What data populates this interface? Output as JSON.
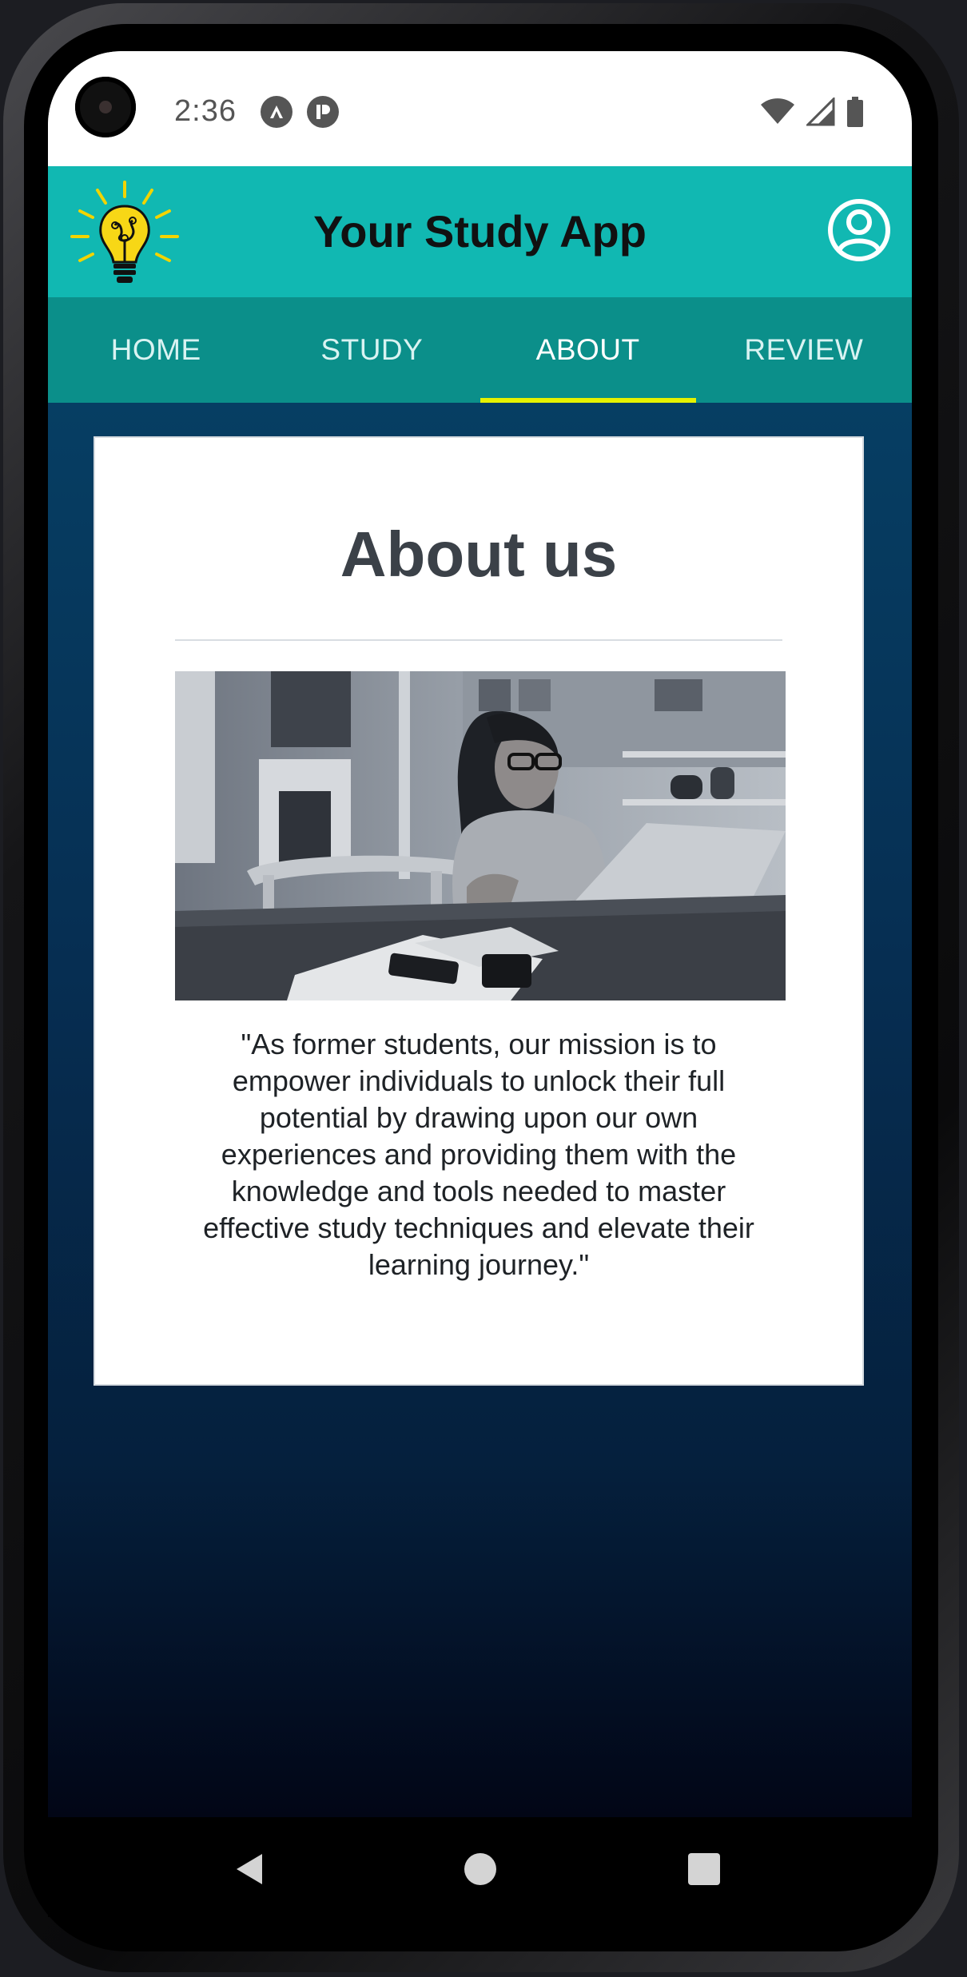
{
  "status_bar": {
    "time": "2:36",
    "icons": [
      "notification-a-icon",
      "notification-p-icon"
    ],
    "right_icons": [
      "wifi-icon",
      "signal-icon",
      "battery-icon"
    ]
  },
  "app_bar": {
    "title": "Your Study App",
    "logo_icon": "lightbulb-logo-icon",
    "profile_icon": "account-circle-icon"
  },
  "tabs": [
    {
      "label": "HOME",
      "active": false
    },
    {
      "label": "STUDY",
      "active": false
    },
    {
      "label": "ABOUT",
      "active": true
    },
    {
      "label": "REVIEW",
      "active": false
    }
  ],
  "about": {
    "title": "About us",
    "image_alt": "Woman studying at a laptop",
    "quote": "\"As former students, our mission is to empower individuals to unlock their full potential by drawing upon our own experiences and providing them with the knowledge and tools needed to master effective study techniques and elevate their learning journey.\""
  },
  "nav_bar": {
    "buttons": [
      "back-icon",
      "home-icon",
      "recents-icon"
    ]
  },
  "colors": {
    "app_bar": "#11b8b2",
    "tabs": "#0b8f8a",
    "tab_indicator": "#e6f200",
    "background_top": "#063e63",
    "background_bottom": "#020616"
  }
}
